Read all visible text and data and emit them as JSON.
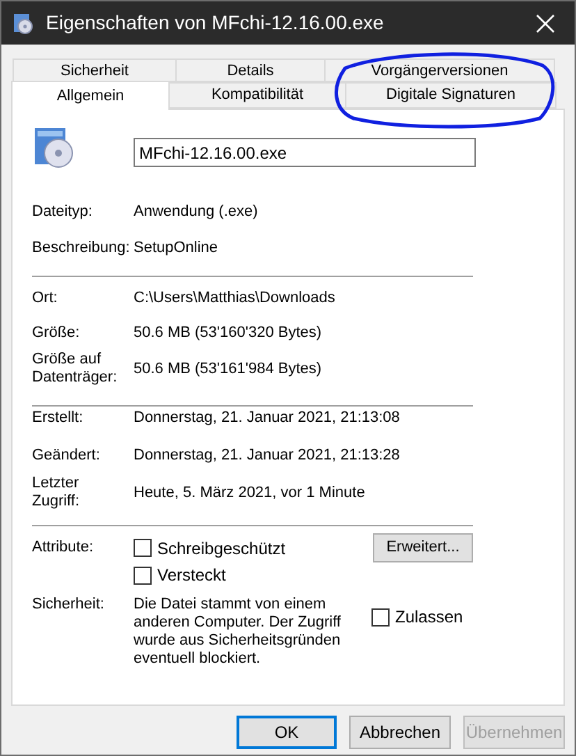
{
  "window": {
    "title": "Eigenschaften von MFchi-12.16.00.exe"
  },
  "tab_rows": [
    {
      "tabs": [
        {
          "label": "Sicherheit",
          "selected": false
        },
        {
          "label": "Details",
          "selected": false
        },
        {
          "label": "Vorgängerversionen",
          "selected": false
        }
      ]
    },
    {
      "tabs": [
        {
          "label": "Allgemein",
          "selected": true
        },
        {
          "label": "Kompatibilität",
          "selected": false
        },
        {
          "label": "Digitale Signaturen",
          "selected": false
        }
      ]
    }
  ],
  "file_name": {
    "value": "MFchi-12.16.00.exe"
  },
  "sections": [
    {
      "rows": [
        {
          "label": "Dateityp:",
          "value": "Anwendung (.exe)"
        },
        {
          "label": "Beschreibung:",
          "value": "SetupOnline"
        }
      ]
    },
    {
      "rows": [
        {
          "label": "Ort:",
          "value": "C:\\Users\\Matthias\\Downloads"
        },
        {
          "label": "Größe:",
          "value": "50.6 MB (53'160'320 Bytes)"
        },
        {
          "label": "Größe auf Datenträger:",
          "value": "50.6 MB (53'161'984 Bytes)"
        }
      ]
    },
    {
      "rows": [
        {
          "label": "Erstellt:",
          "value": "Donnerstag, 21. Januar 2021, 21:13:08"
        },
        {
          "label": "Geändert:",
          "value": "Donnerstag, 21. Januar 2021, 21:13:28"
        },
        {
          "label": "Letzter Zugriff:",
          "value": "Heute, 5. März 2021, vor 1 Minute"
        }
      ]
    }
  ],
  "attributes": {
    "label": "Attribute:",
    "checkboxes": [
      {
        "label": "Schreibgeschützt",
        "checked": false
      },
      {
        "label": "Versteckt",
        "checked": false
      }
    ],
    "button": "Erweitert..."
  },
  "security": {
    "label": "Sicherheit:",
    "text": "Die Datei stammt von einem anderen Computer. Der Zugriff wurde aus Sicherheitsgründen eventuell blockiert.",
    "checkbox": {
      "label": "Zulassen",
      "checked": false
    }
  },
  "buttons": [
    {
      "label": "OK",
      "default": true,
      "disabled": false
    },
    {
      "label": "Abbrechen",
      "default": false,
      "disabled": false
    },
    {
      "label": "Übernehmen",
      "default": false,
      "disabled": true
    }
  ]
}
